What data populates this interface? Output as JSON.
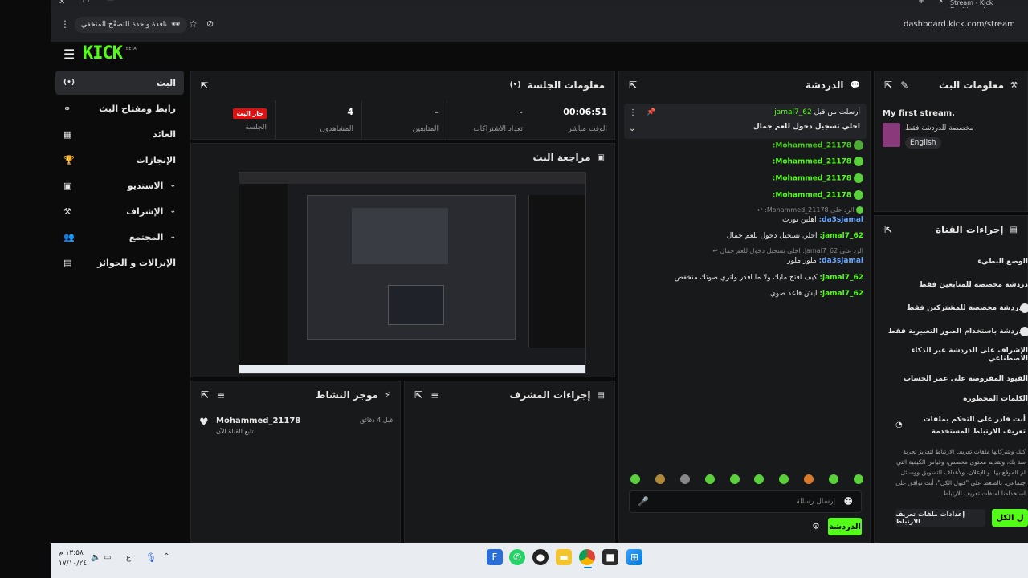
{
  "browser": {
    "tab_title": "Stream - Kick Dashboard",
    "incognito_label": "نافذة واحدة للتصفّح المتخفي",
    "url": "dashboard.kick.com/stream"
  },
  "app": {
    "logo": "KICK",
    "logo_beta": "BETA"
  },
  "sidebar": {
    "items": [
      {
        "label": "البث"
      },
      {
        "label": "رابط ومفتاح البث"
      },
      {
        "label": "العائد"
      },
      {
        "label": "الإنجازات"
      },
      {
        "label": "الاستديو"
      },
      {
        "label": "الإشراف"
      },
      {
        "label": "المجتمع"
      },
      {
        "label": "الإنزالات و الجوائز"
      }
    ]
  },
  "session": {
    "title": "معلومات الجلسة",
    "live_badge": "جار البث",
    "session_label": "الجلسة",
    "viewers_value": "4",
    "viewers_label": "المشاهدون",
    "followers_value": "-",
    "followers_label": "المتابعين",
    "subs_value": "-",
    "subs_label": "تعداد الاشتراكات",
    "uptime_value": "00:06:51",
    "uptime_label": "الوقت مباشر"
  },
  "preview": {
    "title": "مراجعة البث"
  },
  "activity": {
    "title": "موجز النشاط",
    "user": "Mohammed_21178",
    "time": "قبل 4 دقائق",
    "desc": "تابع القناة الآن"
  },
  "modactions": {
    "title": "إجراءات المشرف"
  },
  "chat": {
    "title": "الدردشة",
    "pinned_by_prefix": "أرسلت من قبل",
    "pinned_user": "jamal7_62",
    "pinned_text": "اخلي تسجيل دخول للعم جمال",
    "messages": [
      {
        "user": "Mohammed_21178:"
      },
      {
        "user": "Mohammed_21178:"
      },
      {
        "user": "Mohammed_21178:"
      },
      {
        "user": "Mohammed_21178:"
      }
    ],
    "reply1_ref": "الرد على Mohammed_21178:",
    "reply1_user": "da3sjamal:",
    "reply1_text": "اهلين نورت",
    "msg2_user": "jamal7_62:",
    "msg2_text": "اخلي تسجيل دخول للعم جمال",
    "reply2_ref": "الرد على jamal7_62: اخلي تسجيل دخول للعم جمال",
    "reply2_user": "da3sjamal:",
    "reply2_text": "ملور ملور",
    "msg3_user": "jamal7_62:",
    "msg3_text": "كيف افتح مايك ولا ما افدر واتري صوتك منخفض",
    "msg4_user": "jamal7_62:",
    "msg4_text": "ايش قاعد صوي",
    "input_placeholder": "إرسال رسالة",
    "send_label": "الدردشة"
  },
  "streaminfo": {
    "title": "معلومات البث",
    "stream_title": "My first stream.",
    "category": "مخصصة للدردشة فقط",
    "language": "English"
  },
  "channel_actions": {
    "title": "إجراءات القناة",
    "rows": [
      {
        "label": "الوضع البطيء"
      },
      {
        "label": "دردشة مخصصة للمتابعين فقط"
      },
      {
        "label": "الدردشة مخصصة للمشتركين فقط"
      },
      {
        "label": "الدردشة باستخدام الصور التعبيرية فقط"
      },
      {
        "label": "الإشراف على الدردشة عبر الذكاء الاصطناعي"
      },
      {
        "label": "القيود المفروضة على عمر الحساب"
      },
      {
        "label": "الكلمات المحظورة"
      }
    ]
  },
  "cookies": {
    "heading": "أنت قادر على التحكم بملفات تعريف الارتباط المستخدمة",
    "body": "كيك وشركائها ملفات تعريف الارتباط لتعزيز تجربة سة بك، وتقديم محتوى مخصص، وقياس الكيفية التي ام الموقع بها، و الإعلان، ولأهداف التسويق ووسائل جتماعي. بالضغط على \"قبول الكل\"، أنت توافق على استخدامنا لملفات تعريف الارتباط.",
    "settings_label": "إعدادات ملفات تعريف الارتباط",
    "accept_label": "ل الكل"
  },
  "taskbar": {
    "time": "١٣:٥٨ م",
    "date": "١٧/١٠/٢٤",
    "lang": "ع"
  },
  "colors": {
    "accent": "#53fc18",
    "panel": "#18191b",
    "bg": "#0b0b0c"
  }
}
